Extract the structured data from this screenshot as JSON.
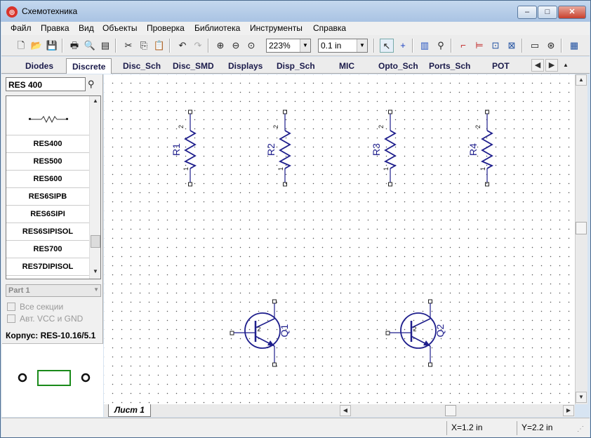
{
  "window": {
    "title": "Схемотехника",
    "min": "–",
    "max": "□",
    "close": "✕"
  },
  "menu": [
    "Файл",
    "Правка",
    "Вид",
    "Объекты",
    "Проверка",
    "Библиотека",
    "Инструменты",
    "Справка"
  ],
  "toolbar": {
    "zoom": "223%",
    "grid": "0.1 in"
  },
  "tabs": [
    "Diodes",
    "Discrete",
    "Disc_Sch",
    "Disc_SMD",
    "Displays",
    "Disp_Sch",
    "MIC",
    "Opto_Sch",
    "Ports_Sch",
    "POT"
  ],
  "active_tab": "Discrete",
  "library": {
    "search": "RES 400",
    "items": [
      "RES400",
      "RES500",
      "RES600",
      "RES6SIPB",
      "RES6SIPI",
      "RES6SIPISOL",
      "RES700",
      "RES7DIPISOL"
    ],
    "part": "Part 1",
    "all_sections": "Все секции",
    "auto_vcc": "Авт. VCC и GND",
    "package": "Корпус: RES-10.16/5.1"
  },
  "schematic": {
    "resistors": [
      "R1",
      "R2",
      "R3",
      "R4"
    ],
    "transistors": [
      "Q1",
      "Q2"
    ],
    "pin1": "1",
    "pin2": "2",
    "pin3": "3"
  },
  "sheet_tab": "Лист 1",
  "status": {
    "x": "X=1.2 in",
    "y": "Y=2.2 in"
  },
  "colors": {
    "wire": "#1e1e8c",
    "pin": "#222222"
  }
}
